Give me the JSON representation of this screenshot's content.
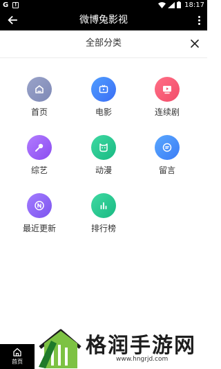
{
  "status_bar": {
    "left_letter": "G",
    "warn_mark": "!",
    "time": "18:17"
  },
  "app_bar": {
    "title": "微博兔影视"
  },
  "sheet": {
    "title": "全部分类"
  },
  "categories": [
    {
      "label": "首页",
      "icon": "home-icon",
      "color_from": "#9aa3c9",
      "color_to": "#7e89b6"
    },
    {
      "label": "电影",
      "icon": "tv-icon",
      "color_from": "#4f9dff",
      "color_to": "#3b6ef5"
    },
    {
      "label": "连续剧",
      "icon": "play-screen-icon",
      "color_from": "#ff6f86",
      "color_to": "#f24d6a"
    },
    {
      "label": "综艺",
      "icon": "microphone-icon",
      "color_from": "#b27cff",
      "color_to": "#8a4cf0"
    },
    {
      "label": "动漫",
      "icon": "cartoon-face-icon",
      "color_from": "#3fd9a2",
      "color_to": "#19b982"
    },
    {
      "label": "留言",
      "icon": "message-icon",
      "color_from": "#5aa8ff",
      "color_to": "#3b7cf5"
    },
    {
      "label": "最近更新",
      "icon": "new-icon",
      "color_from": "#a37cff",
      "color_to": "#7c54ee"
    },
    {
      "label": "排行榜",
      "icon": "bar-chart-icon",
      "color_from": "#3fd9a2",
      "color_to": "#19b982"
    }
  ],
  "bottom_nav": {
    "home_label": "首页"
  },
  "watermark": {
    "title": "格润手游网",
    "url": "www.hngrjd.com"
  }
}
